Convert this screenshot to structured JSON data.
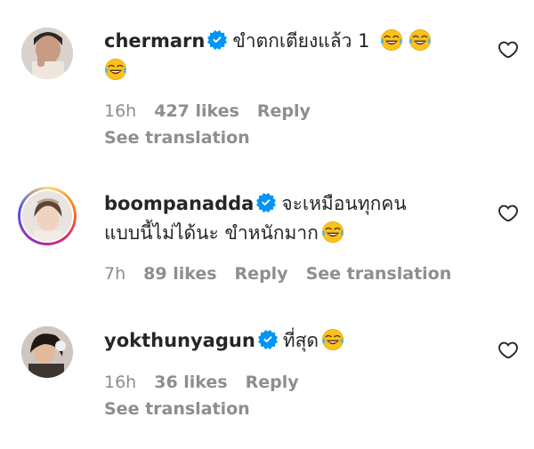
{
  "comments": [
    {
      "username": "chermarn",
      "text_line1": "ขำตกเตียงแล้ว 1",
      "text_line2": "",
      "emoji_count_line1": 2,
      "emoji_count_line2": 1,
      "time": "16h",
      "likes": "427 likes",
      "reply": "Reply",
      "see_translation": "See translation",
      "verified": true
    },
    {
      "username": "boompanadda",
      "text_line1": "จะเหมือนทุกคน",
      "text_line2": "แบบนี้ไม่ได้นะ ขำหนักมาก",
      "emoji_count_line1": 0,
      "emoji_count_line2": 1,
      "time": "7h",
      "likes": "89 likes",
      "reply": "Reply",
      "see_translation": "See translation",
      "verified": true,
      "has_story_ring": true
    },
    {
      "username": "yokthunyagun",
      "text_line1": "ที่สุด",
      "text_line2": "",
      "emoji_count_line1": 1,
      "emoji_count_line2": 0,
      "time": "16h",
      "likes": "36 likes",
      "reply": "Reply",
      "see_translation": "See translation",
      "verified": true
    }
  ],
  "icons": {
    "verified": "verified-badge-icon",
    "like": "heart-outline-icon",
    "emoji": "face-with-tears-of-joy"
  },
  "colors": {
    "verified_blue": "#0095f6",
    "muted_text": "#8e8e8e",
    "primary_text": "#262626"
  }
}
